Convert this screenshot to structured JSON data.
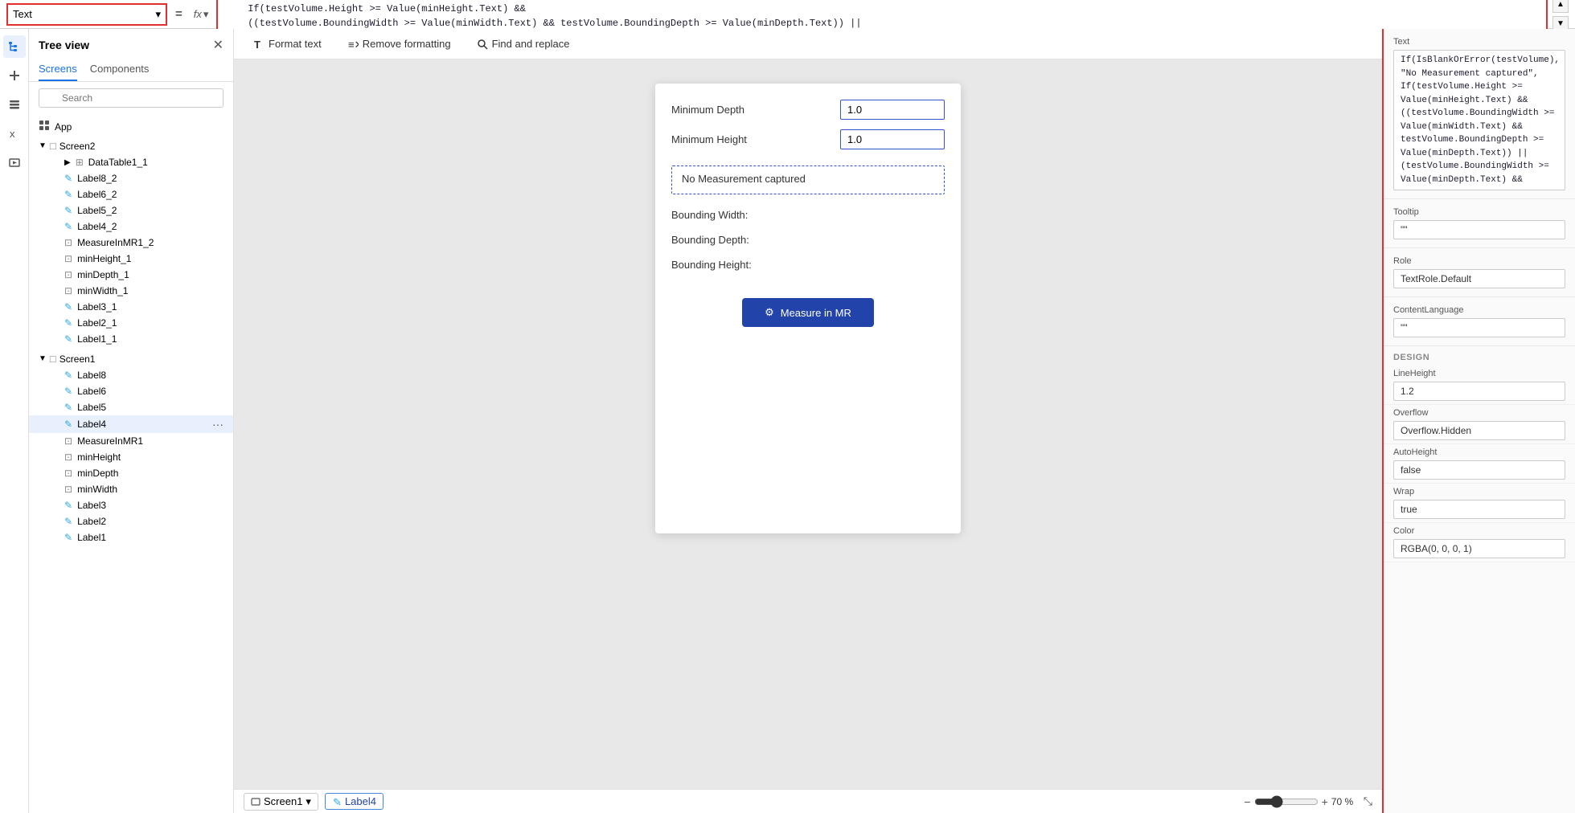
{
  "formulaBar": {
    "selectorLabel": "Text",
    "eqSign": "=",
    "fxLabel": "fx",
    "expression": "If(IsBlankOrError(testVolume), \"No Measurement captured\",\n    If(testVolume.Height >= Value(minHeight.Text) &&\n    ((testVolume.BoundingWidth >= Value(minWidth.Text) && testVolume.BoundingDepth >= Value(minDepth.Text)) ||\n    (testVolume.BoundingWidth >= Value(minDepth.Text) && testVolume.BoundingDepth >= Value(minWidth.Text))),\n    \"Fit Test Succeeded\", \"Fit Test Failed\"))",
    "scrollUp": "▲",
    "scrollDown": "▼"
  },
  "sidebar": {
    "treeViewTitle": "Tree view",
    "tabs": [
      {
        "label": "Screens",
        "active": true
      },
      {
        "label": "Components",
        "active": false
      }
    ],
    "searchPlaceholder": "Search",
    "appItem": "App",
    "screen2": {
      "label": "Screen2",
      "children": [
        {
          "label": "DataTable1_1",
          "type": "table",
          "indent": 2
        },
        {
          "label": "Label8_2",
          "type": "label",
          "indent": 2
        },
        {
          "label": "Label6_2",
          "type": "label",
          "indent": 2
        },
        {
          "label": "Label5_2",
          "type": "label",
          "indent": 2
        },
        {
          "label": "Label4_2",
          "type": "label",
          "indent": 2
        },
        {
          "label": "MeasureInMR1_2",
          "type": "measure",
          "indent": 2
        },
        {
          "label": "minHeight_1",
          "type": "input",
          "indent": 2
        },
        {
          "label": "minDepth_1",
          "type": "input",
          "indent": 2
        },
        {
          "label": "minWidth_1",
          "type": "input",
          "indent": 2
        },
        {
          "label": "Label3_1",
          "type": "label",
          "indent": 2
        },
        {
          "label": "Label2_1",
          "type": "label",
          "indent": 2
        },
        {
          "label": "Label1_1",
          "type": "label",
          "indent": 2
        }
      ]
    },
    "screen1": {
      "label": "Screen1",
      "children": [
        {
          "label": "Label8",
          "type": "label"
        },
        {
          "label": "Label6",
          "type": "label"
        },
        {
          "label": "Label5",
          "type": "label"
        },
        {
          "label": "Label4",
          "type": "label",
          "selected": true
        },
        {
          "label": "MeasureInMR1",
          "type": "measure"
        },
        {
          "label": "minHeight",
          "type": "input"
        },
        {
          "label": "minDepth",
          "type": "input"
        },
        {
          "label": "minWidth",
          "type": "input"
        },
        {
          "label": "Label3",
          "type": "label"
        },
        {
          "label": "Label2",
          "type": "label"
        },
        {
          "label": "Label1",
          "type": "label"
        }
      ]
    }
  },
  "toolbar": {
    "formatText": "Format text",
    "removeFormatting": "Remove formatting",
    "findAndReplace": "Find and replace"
  },
  "canvas": {
    "minimumDepthLabel": "Minimum Depth",
    "minimumDepthValue": "1.0",
    "minimumHeightLabel": "Minimum Height",
    "minimumHeightValue": "1.0",
    "outputText": "No Measurement captured",
    "boundingWidthLabel": "Bounding Width:",
    "boundingDepthLabel": "Bounding Depth:",
    "boundingHeightLabel": "Bounding Height:",
    "measureBtnIcon": "⚙",
    "measureBtnLabel": "Measure in MR"
  },
  "statusBar": {
    "screen": "Screen1",
    "label": "Label4",
    "zoomMinus": "−",
    "zoomPlus": "+",
    "zoomValue": "70 %",
    "fitIcon": "⤡"
  },
  "propertiesPanel": {
    "textLabel": "Text",
    "textValue": "If(IsBlankOrError(testVolume), \"No Measurement captured\",\nIf(testVolume.Height >=\nValue(minHeight.Text) &&\n((testVolume.BoundingWidth >=\nValue(minWidth.Text) &&\ntestVolume.BoundingDepth >=\nValue(minDepth.Text)) ||\n(testVolume.BoundingWidth >=\nValue(minDepth.Text) &&",
    "tooltipLabel": "Tooltip",
    "tooltipValue": "\"\"",
    "roleLabel": "Role",
    "roleValue": "TextRole.Default",
    "contentLanguageLabel": "ContentLanguage",
    "contentLanguageValue": "\"\"",
    "designTitle": "DESIGN",
    "lineHeightLabel": "LineHeight",
    "lineHeightValue": "1.2",
    "overflowLabel": "Overflow",
    "overflowValue": "Overflow.Hidden",
    "autoHeightLabel": "AutoHeight",
    "autoHeightValue": "false",
    "wrapLabel": "Wrap",
    "wrapValue": "true",
    "colorLabel": "Color",
    "colorValue": "RGBA(0, 0, 0, 1)"
  }
}
